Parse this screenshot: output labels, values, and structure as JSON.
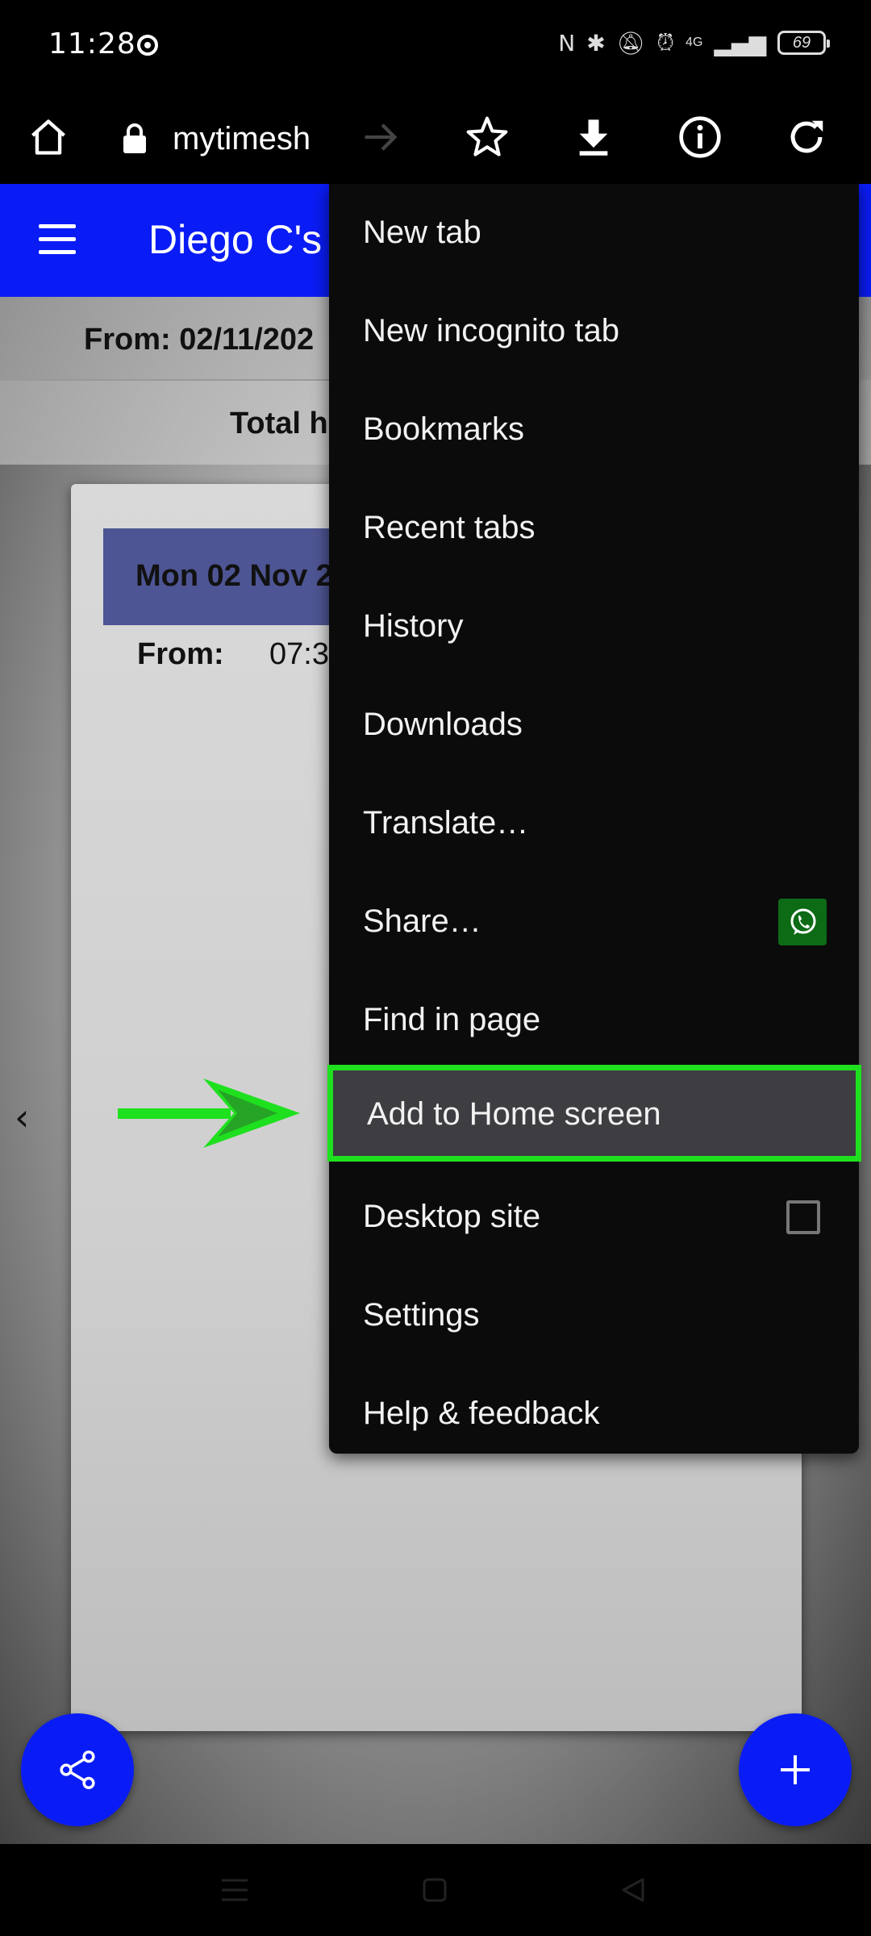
{
  "status_bar": {
    "time": "11:28",
    "signal_label": "4G",
    "battery": "69"
  },
  "toolbar": {
    "url": "mytimesh",
    "icons": [
      "home-icon",
      "lock-icon",
      "forward-icon",
      "star-icon",
      "download-icon",
      "info-icon",
      "refresh-icon"
    ]
  },
  "page": {
    "app_title": "Diego C's",
    "from_range": "From: 02/11/202",
    "total_hours": "Total h",
    "day_label": "Mon 02 Nov 2",
    "from_label": "From:",
    "from_time": "07:3"
  },
  "menu": {
    "items": [
      {
        "label": "New tab"
      },
      {
        "label": "New incognito tab"
      },
      {
        "label": "Bookmarks"
      },
      {
        "label": "Recent tabs"
      },
      {
        "label": "History"
      },
      {
        "label": "Downloads"
      },
      {
        "label": "Translate…"
      },
      {
        "label": "Share…"
      },
      {
        "label": "Find in page"
      },
      {
        "label": "Add to Home screen"
      },
      {
        "label": "Desktop site"
      },
      {
        "label": "Settings"
      },
      {
        "label": "Help & feedback"
      }
    ],
    "highlighted_item": "Add to Home screen",
    "desktop_site_checked": false,
    "share_app_icon": "whatsapp-icon"
  },
  "colors": {
    "app_bar": "#0a1cf5",
    "highlight_border": "#1fe01f",
    "annotation_arrow": "#1fe01f",
    "whatsapp_badge": "#0d6b16"
  }
}
